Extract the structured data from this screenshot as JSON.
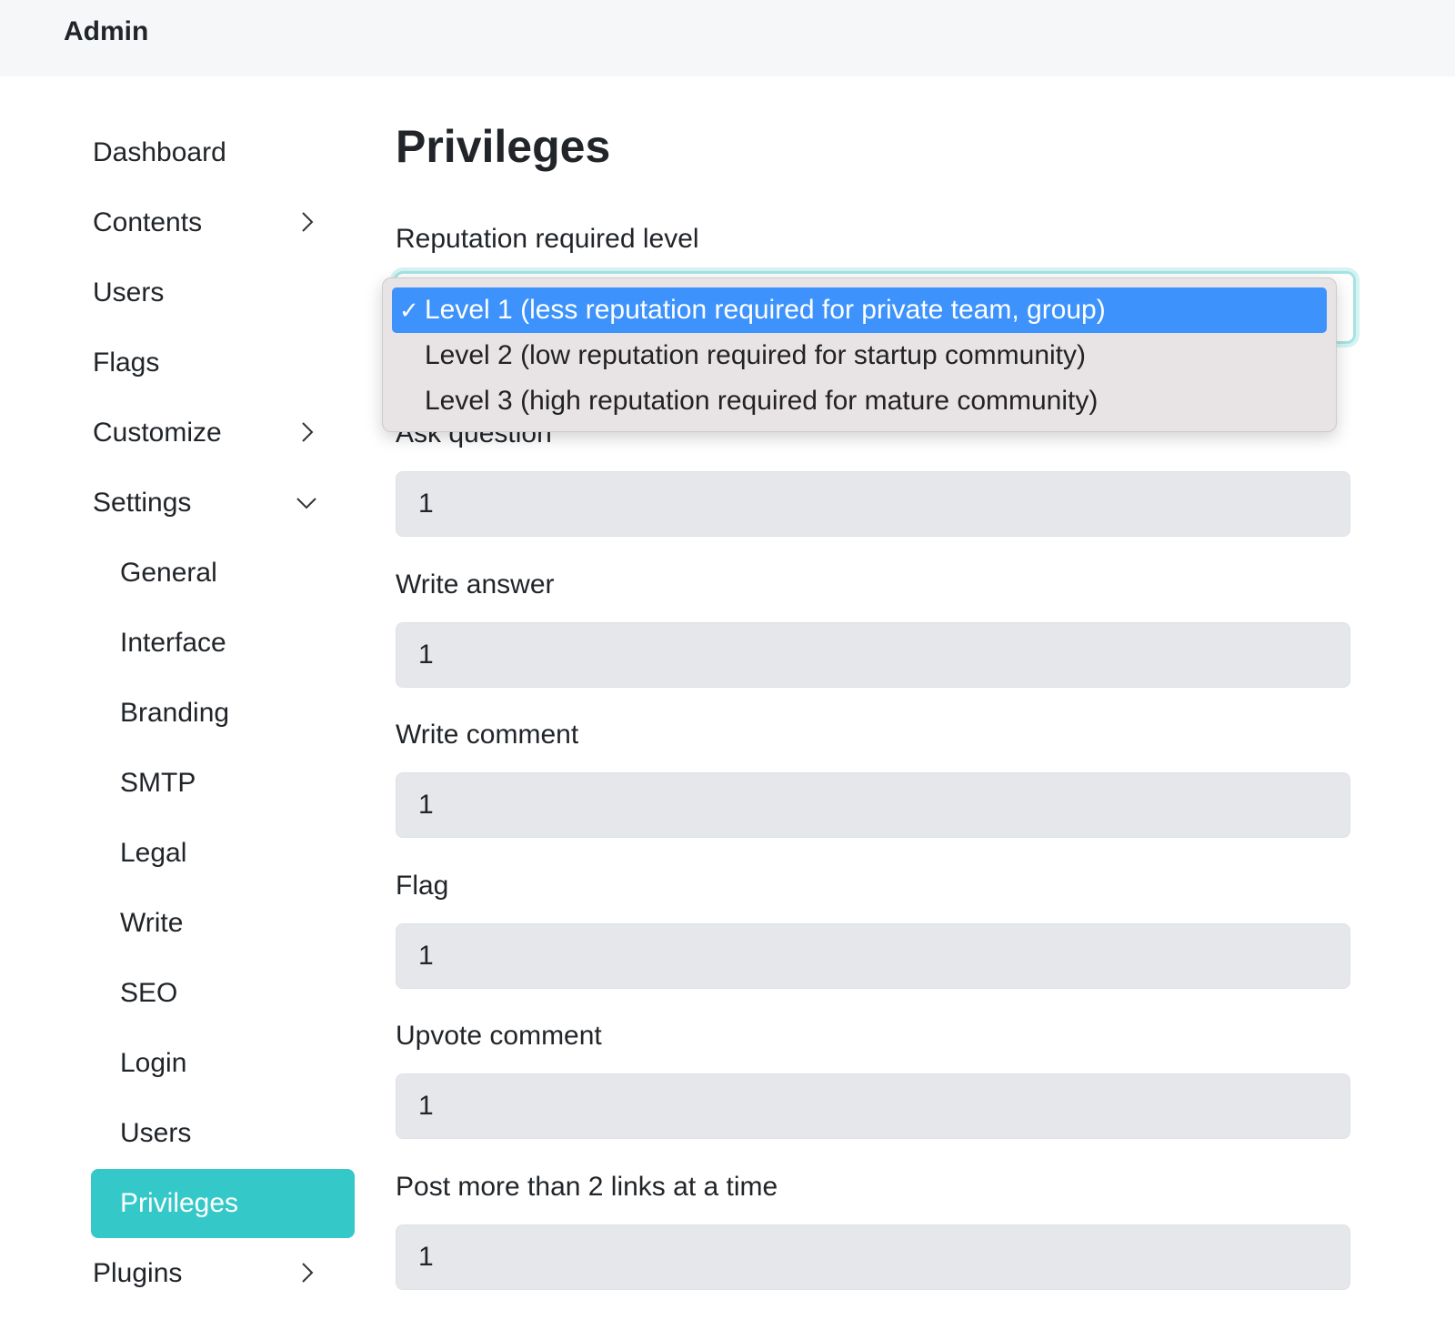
{
  "header": {
    "title": "Admin"
  },
  "sidebar": {
    "items": [
      {
        "label": "Dashboard",
        "chevron": ""
      },
      {
        "label": "Contents",
        "chevron": "right"
      },
      {
        "label": "Users",
        "chevron": ""
      },
      {
        "label": "Flags",
        "chevron": ""
      },
      {
        "label": "Customize",
        "chevron": "right"
      },
      {
        "label": "Settings",
        "chevron": "down"
      }
    ],
    "sub_items": [
      "General",
      "Interface",
      "Branding",
      "SMTP",
      "Legal",
      "Write",
      "SEO",
      "Login",
      "Users",
      "Privileges"
    ],
    "active": "Privileges",
    "after_items": [
      {
        "label": "Plugins",
        "chevron": "right"
      }
    ]
  },
  "main": {
    "title": "Privileges",
    "level_label": "Reputation required level",
    "level_options": [
      "Level 1 (less reputation required for private team, group)",
      "Level 2 (low reputation required for startup community)",
      "Level 3 (high reputation required for mature community)"
    ],
    "selected_index": 0,
    "check": "✓",
    "fields": [
      {
        "label": "Ask question",
        "value": "1"
      },
      {
        "label": "Write answer",
        "value": "1"
      },
      {
        "label": "Write comment",
        "value": "1"
      },
      {
        "label": "Flag",
        "value": "1"
      },
      {
        "label": "Upvote comment",
        "value": "1"
      },
      {
        "label": "Post more than 2 links at a time",
        "value": "1"
      }
    ]
  },
  "colors": {
    "accent": "#35c8c8",
    "selected_option": "#3d93fb",
    "input_bg": "#e5e7ea"
  }
}
